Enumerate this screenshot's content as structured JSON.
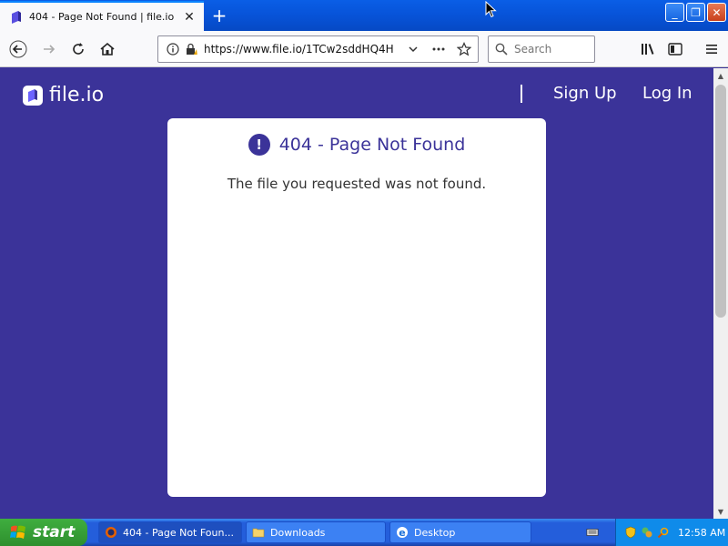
{
  "browser": {
    "tab_title": "404 - Page Not Found | file.io",
    "tab_close": "✕",
    "new_tab": "+",
    "url": "https://www.file.io/1TCw2sddHQ4H",
    "search_placeholder": "Search",
    "window_minimize": "_",
    "window_restore": "❐",
    "window_close": "✕"
  },
  "site": {
    "logo_text": "file.io",
    "nav": {
      "signup": "Sign Up",
      "login": "Log In"
    }
  },
  "error_card": {
    "icon_glyph": "!",
    "title": "404 - Page Not Found",
    "message": "The file you requested was not found."
  },
  "taskbar": {
    "start_label": "start",
    "tasks": [
      {
        "label": "404 - Page Not Foun..."
      },
      {
        "label": "Downloads"
      },
      {
        "label": "Desktop"
      }
    ],
    "clock": "12:58 AM"
  },
  "colors": {
    "brand": "#3b3399",
    "card": "#ffffff",
    "taskbar": "#245edb",
    "start": "#2e8f2e"
  }
}
